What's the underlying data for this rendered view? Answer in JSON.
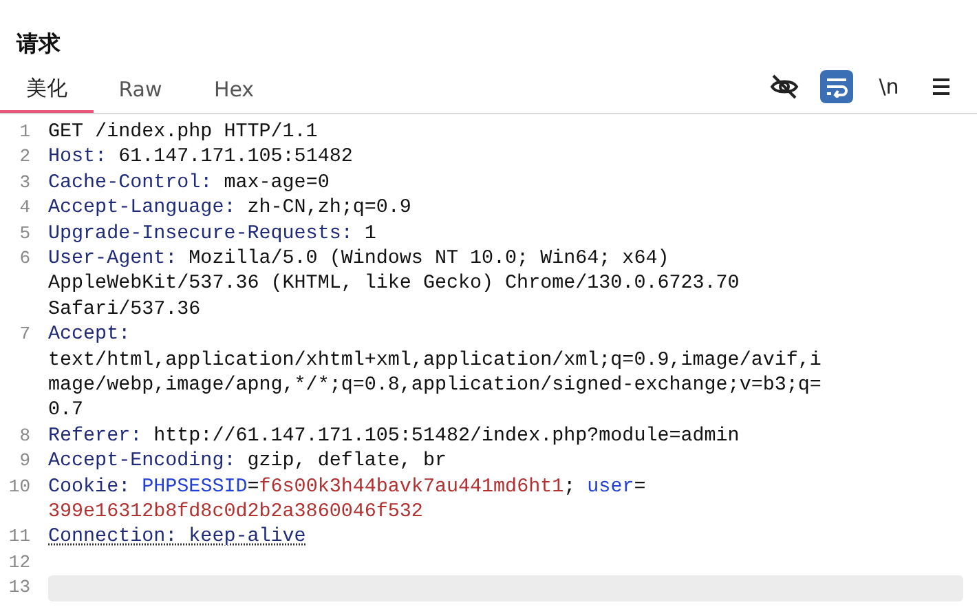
{
  "panel": {
    "title": "请求"
  },
  "tabs": [
    {
      "label": "美化",
      "selected": true
    },
    {
      "label": "Raw",
      "selected": false
    },
    {
      "label": "Hex",
      "selected": false
    }
  ],
  "toolbar": [
    {
      "kind": "hide",
      "on": false
    },
    {
      "kind": "wrap",
      "on": true
    },
    {
      "kind": "newline",
      "label": "\\n",
      "on": false
    },
    {
      "kind": "menu",
      "on": false
    }
  ],
  "lines": [
    {
      "number": "1",
      "rows": [
        [
          {
            "kind": "plain",
            "text": "GET /index.php HTTP/1.1"
          }
        ]
      ]
    },
    {
      "number": "2",
      "rows": [
        [
          {
            "kind": "name",
            "text": "Host: "
          },
          {
            "kind": "plain",
            "text": "61.147.171.105:51482"
          }
        ]
      ]
    },
    {
      "number": "3",
      "rows": [
        [
          {
            "kind": "name",
            "text": "Cache-Control: "
          },
          {
            "kind": "plain",
            "text": "max-age=0"
          }
        ]
      ]
    },
    {
      "number": "4",
      "rows": [
        [
          {
            "kind": "name",
            "text": "Accept-Language: "
          },
          {
            "kind": "plain",
            "text": "zh-CN,zh;q=0.9"
          }
        ]
      ]
    },
    {
      "number": "5",
      "rows": [
        [
          {
            "kind": "name",
            "text": "Upgrade-Insecure-Requests: "
          },
          {
            "kind": "plain",
            "text": "1"
          }
        ]
      ]
    },
    {
      "number": "6",
      "rows": [
        [
          {
            "kind": "name",
            "text": "User-Agent: "
          },
          {
            "kind": "plain",
            "text": "Mozilla/5.0 (Windows NT 10.0; Win64; x64)"
          }
        ],
        [
          {
            "kind": "plain",
            "text": "AppleWebKit/537.36 (KHTML, like Gecko) Chrome/130.0.6723.70"
          }
        ],
        [
          {
            "kind": "plain",
            "text": "Safari/537.36"
          }
        ]
      ]
    },
    {
      "number": "7",
      "rows": [
        [
          {
            "kind": "name",
            "text": "Accept:"
          }
        ],
        [
          {
            "kind": "plain",
            "text": "text/html,application/xhtml+xml,application/xml;q=0.9,image/avif,i"
          }
        ],
        [
          {
            "kind": "plain",
            "text": "mage/webp,image/apng,*/*;q=0.8,application/signed-exchange;v=b3;q="
          }
        ],
        [
          {
            "kind": "plain",
            "text": "0.7"
          }
        ]
      ]
    },
    {
      "number": "8",
      "rows": [
        [
          {
            "kind": "name",
            "text": "Referer: "
          },
          {
            "kind": "plain",
            "text": "http://61.147.171.105:51482/index.php?module=admin"
          }
        ]
      ]
    },
    {
      "number": "9",
      "rows": [
        [
          {
            "kind": "name",
            "text": "Accept-Encoding: "
          },
          {
            "kind": "plain",
            "text": "gzip, deflate, br"
          }
        ]
      ]
    },
    {
      "number": "10",
      "rows": [
        [
          {
            "kind": "name",
            "text": "Cookie: "
          },
          {
            "kind": "param-name",
            "text": "PHPSESSID"
          },
          {
            "kind": "plain",
            "text": "="
          },
          {
            "kind": "param-value",
            "text": "f6s00k3h44bavk7au441md6ht1"
          },
          {
            "kind": "plain",
            "text": "; "
          },
          {
            "kind": "param-name",
            "text": "user"
          },
          {
            "kind": "plain",
            "text": "="
          }
        ],
        [
          {
            "kind": "param-value",
            "text": "399e16312b8fd8c0d2b2a3860046f532"
          }
        ]
      ]
    },
    {
      "number": "11",
      "rows": [
        [
          {
            "kind": "flagged",
            "text": "Connection: keep-alive"
          }
        ]
      ]
    },
    {
      "number": "12"
    },
    {
      "number": "13",
      "highlighted": true
    }
  ]
}
